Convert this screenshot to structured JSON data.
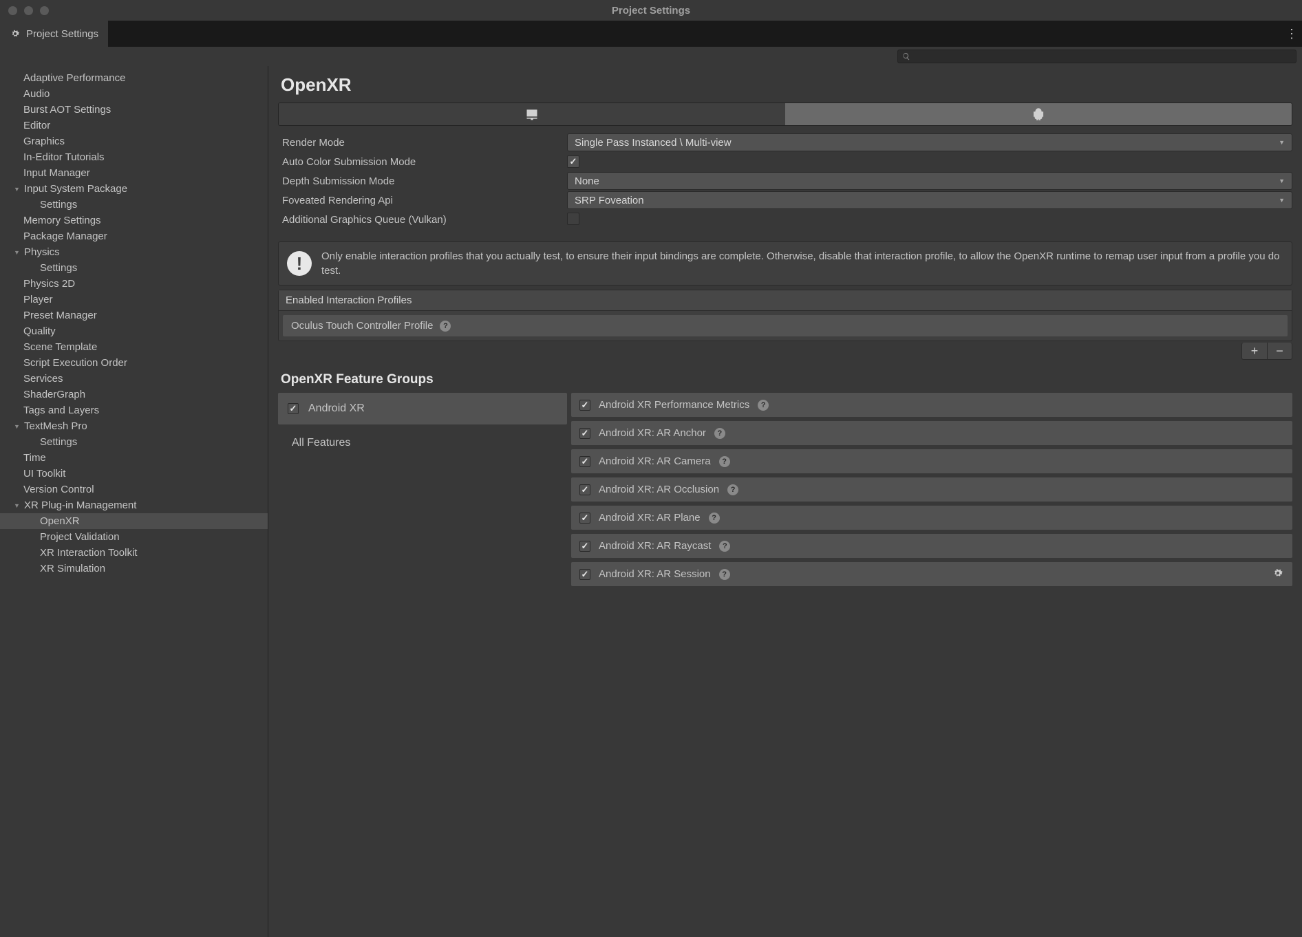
{
  "window": {
    "title": "Project Settings"
  },
  "tab": {
    "label": "Project Settings"
  },
  "sidebar": {
    "items": [
      {
        "label": "Adaptive Performance",
        "depth": 0
      },
      {
        "label": "Audio",
        "depth": 0
      },
      {
        "label": "Burst AOT Settings",
        "depth": 0
      },
      {
        "label": "Editor",
        "depth": 0
      },
      {
        "label": "Graphics",
        "depth": 0
      },
      {
        "label": "In-Editor Tutorials",
        "depth": 0
      },
      {
        "label": "Input Manager",
        "depth": 0
      },
      {
        "label": "Input System Package",
        "depth": 0,
        "expandable": true
      },
      {
        "label": "Settings",
        "depth": 1
      },
      {
        "label": "Memory Settings",
        "depth": 0
      },
      {
        "label": "Package Manager",
        "depth": 0
      },
      {
        "label": "Physics",
        "depth": 0,
        "expandable": true
      },
      {
        "label": "Settings",
        "depth": 1
      },
      {
        "label": "Physics 2D",
        "depth": 0
      },
      {
        "label": "Player",
        "depth": 0
      },
      {
        "label": "Preset Manager",
        "depth": 0
      },
      {
        "label": "Quality",
        "depth": 0
      },
      {
        "label": "Scene Template",
        "depth": 0
      },
      {
        "label": "Script Execution Order",
        "depth": 0
      },
      {
        "label": "Services",
        "depth": 0
      },
      {
        "label": "ShaderGraph",
        "depth": 0
      },
      {
        "label": "Tags and Layers",
        "depth": 0
      },
      {
        "label": "TextMesh Pro",
        "depth": 0,
        "expandable": true
      },
      {
        "label": "Settings",
        "depth": 1
      },
      {
        "label": "Time",
        "depth": 0
      },
      {
        "label": "UI Toolkit",
        "depth": 0
      },
      {
        "label": "Version Control",
        "depth": 0
      },
      {
        "label": "XR Plug-in Management",
        "depth": 0,
        "expandable": true
      },
      {
        "label": "OpenXR",
        "depth": 1,
        "selected": true
      },
      {
        "label": "Project Validation",
        "depth": 1
      },
      {
        "label": "XR Interaction Toolkit",
        "depth": 1
      },
      {
        "label": "XR Simulation",
        "depth": 1
      }
    ]
  },
  "page": {
    "title": "OpenXR",
    "renderMode": {
      "label": "Render Mode",
      "value": "Single Pass Instanced \\ Multi-view"
    },
    "autoColor": {
      "label": "Auto Color Submission Mode",
      "checked": true
    },
    "depthSubmission": {
      "label": "Depth Submission Mode",
      "value": "None"
    },
    "foveated": {
      "label": "Foveated Rendering Api",
      "value": "SRP Foveation"
    },
    "additionalQueue": {
      "label": "Additional Graphics Queue (Vulkan)",
      "checked": false
    },
    "infoText": "Only enable interaction profiles that you actually test, to ensure their input bindings are complete. Otherwise, disable that interaction profile, to allow the OpenXR runtime to remap user input from a profile you do test.",
    "interactionHeader": "Enabled Interaction Profiles",
    "interactionProfiles": [
      {
        "label": "Oculus Touch Controller Profile"
      }
    ],
    "featureGroupsTitle": "OpenXR Feature Groups",
    "featureGroups": [
      {
        "label": "Android XR",
        "checked": true,
        "selected": true
      },
      {
        "label": "All Features",
        "plain": true
      }
    ],
    "features": [
      {
        "label": "Android XR Performance Metrics",
        "checked": true
      },
      {
        "label": "Android XR: AR Anchor",
        "checked": true
      },
      {
        "label": "Android XR: AR Camera",
        "checked": true
      },
      {
        "label": "Android XR: AR Occlusion",
        "checked": true
      },
      {
        "label": "Android XR: AR Plane",
        "checked": true
      },
      {
        "label": "Android XR: AR Raycast",
        "checked": true
      },
      {
        "label": "Android XR: AR Session",
        "checked": true,
        "gear": true
      }
    ]
  }
}
